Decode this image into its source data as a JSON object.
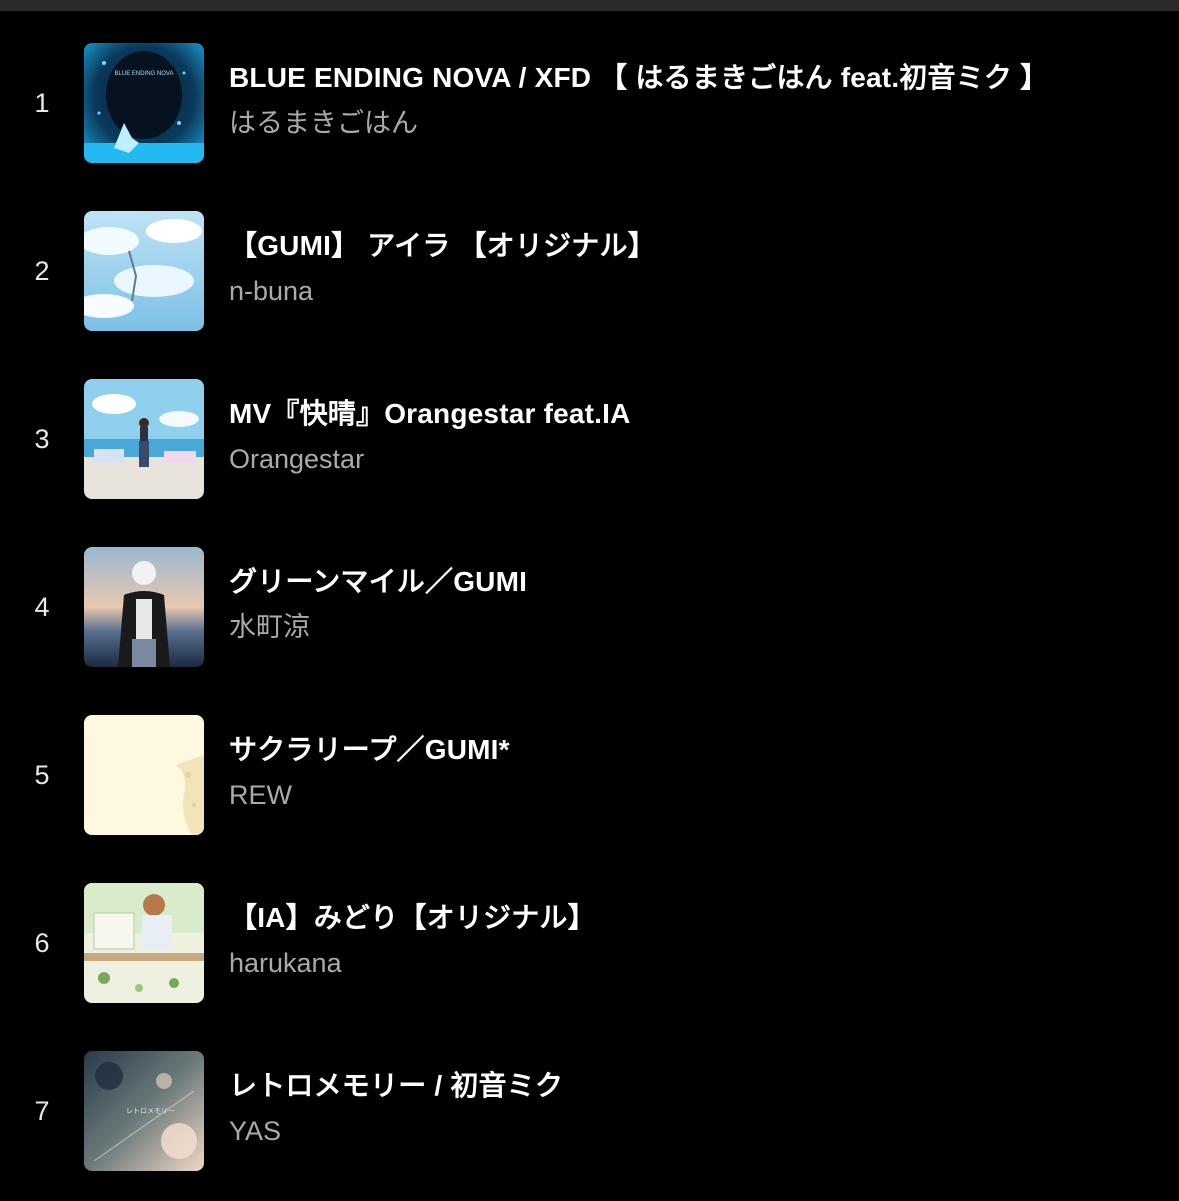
{
  "tracks": [
    {
      "index": "1",
      "title": "BLUE ENDING NOVA / XFD 【 はるまきごはん feat.初音ミク 】",
      "artist": "はるまきごはん",
      "thumbnail_label": "BLUE ENDING NOVA"
    },
    {
      "index": "2",
      "title": "【GUMI】 アイラ 【オリジナル】",
      "artist": "n-buna",
      "thumbnail_label": ""
    },
    {
      "index": "3",
      "title": "MV『快晴』Orangestar feat.IA",
      "artist": "Orangestar",
      "thumbnail_label": ""
    },
    {
      "index": "4",
      "title": "グリーンマイル／GUMI",
      "artist": "水町涼",
      "thumbnail_label": ""
    },
    {
      "index": "5",
      "title": "サクラリープ／GUMI*",
      "artist": "REW",
      "thumbnail_label": ""
    },
    {
      "index": "6",
      "title": "【IA】みどり【オリジナル】",
      "artist": "harukana",
      "thumbnail_label": ""
    },
    {
      "index": "7",
      "title": "レトロメモリー / 初音ミク",
      "artist": "YAS",
      "thumbnail_label": "レトロメモリー"
    }
  ],
  "colors": {
    "background": "#000000",
    "title": "#ffffff",
    "artist": "#aaaaaa",
    "index": "#e8e8e8"
  }
}
